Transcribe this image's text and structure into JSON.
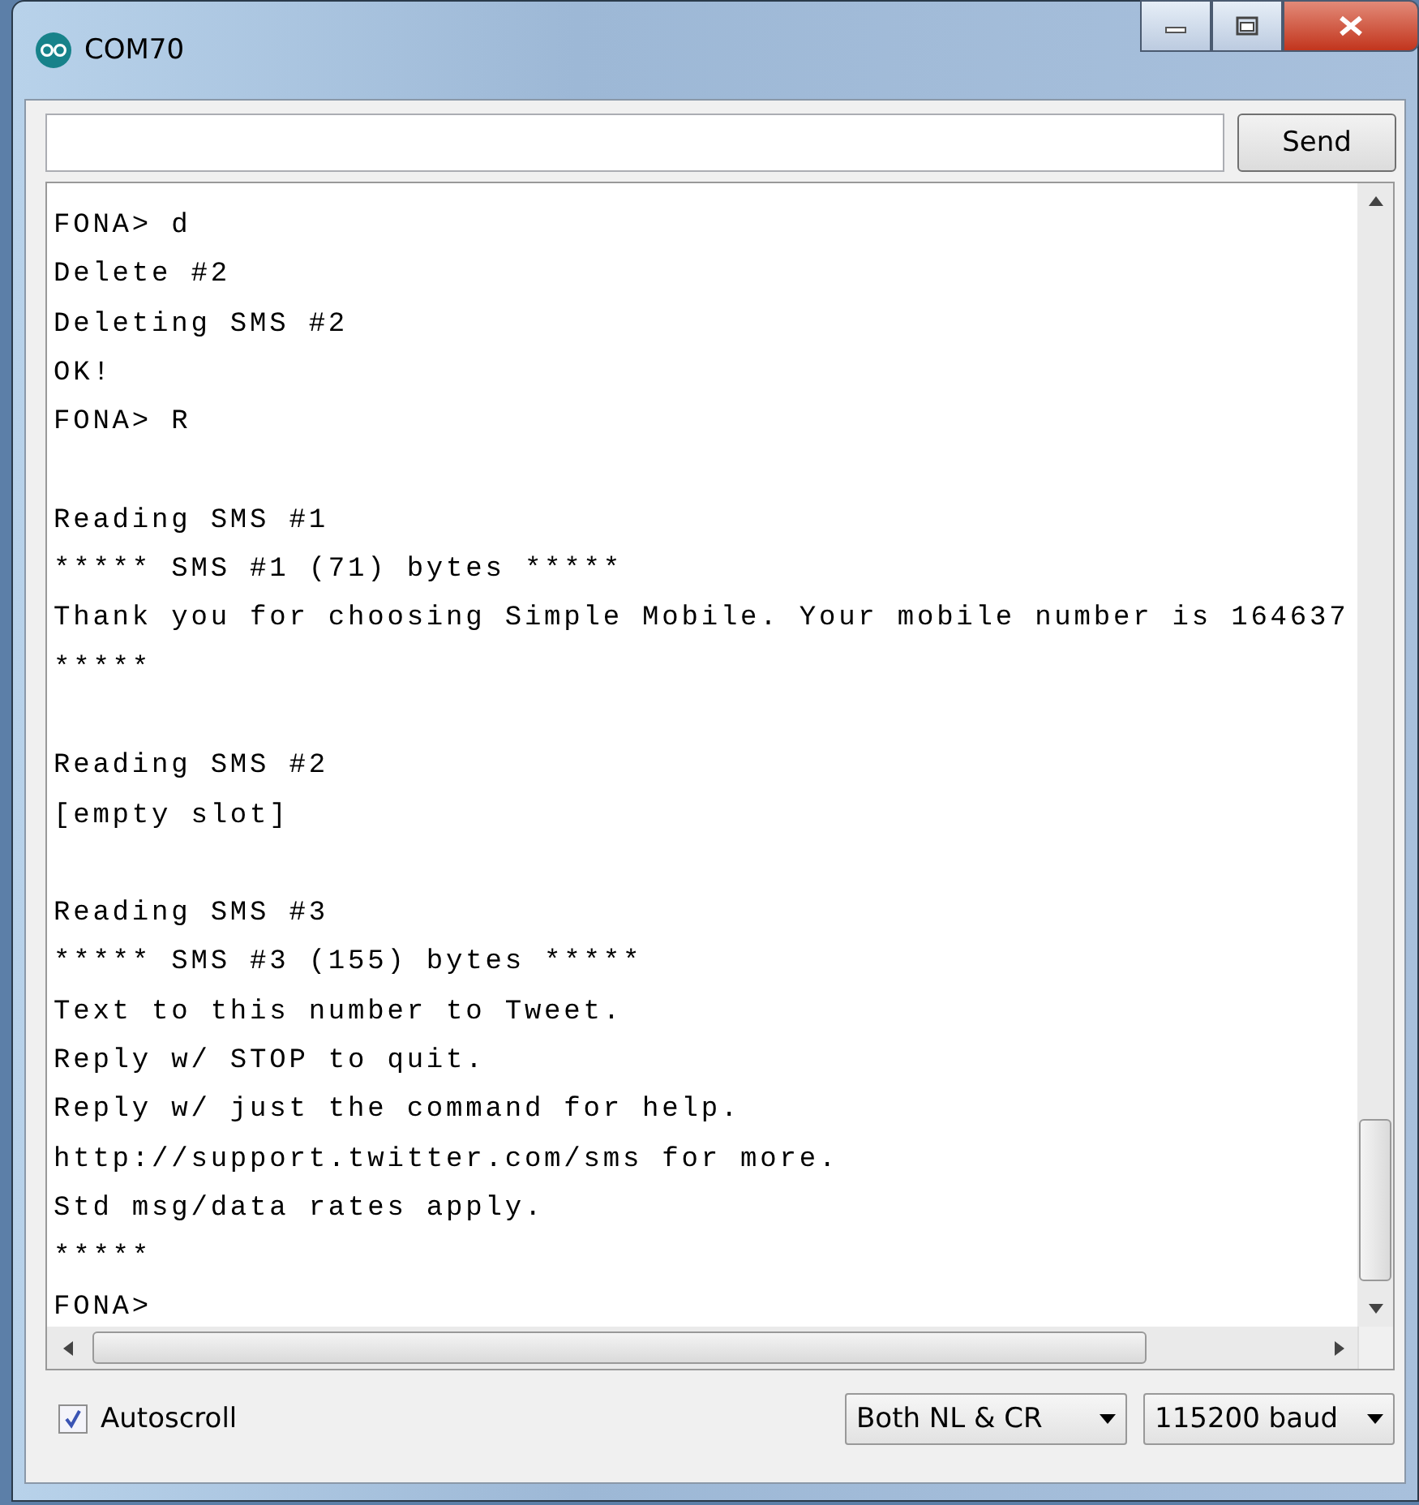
{
  "window": {
    "title": "COM70"
  },
  "input": {
    "button": "Send"
  },
  "output_lines": [
    {
      "text": "FONA> d",
      "blank_before": false
    },
    {
      "text": "Delete #2",
      "blank_before": false
    },
    {
      "text": "Deleting SMS #2",
      "blank_before": false
    },
    {
      "text": "OK!",
      "blank_before": false
    },
    {
      "text": "FONA> R",
      "blank_before": false
    },
    {
      "text": "Reading SMS #1",
      "blank_before": true
    },
    {
      "text": "***** SMS #1 (71) bytes *****",
      "blank_before": false
    },
    {
      "text": "Thank you for choosing Simple Mobile. Your mobile number is 164637",
      "blank_before": false
    },
    {
      "text": "*****",
      "blank_before": false
    },
    {
      "text": "Reading SMS #2",
      "blank_before": true
    },
    {
      "text": "[empty slot]",
      "blank_before": false
    },
    {
      "text": "Reading SMS #3",
      "blank_before": true
    },
    {
      "text": "***** SMS #3 (155) bytes *****",
      "blank_before": false
    },
    {
      "text": "Text to this number to Tweet.",
      "blank_before": false
    },
    {
      "text": "Reply w/ STOP to quit.",
      "blank_before": false
    },
    {
      "text": "Reply w/ just the command for help.",
      "blank_before": false
    },
    {
      "text": "http://support.twitter.com/sms for more.",
      "blank_before": false
    },
    {
      "text": "Std msg/data rates apply.",
      "blank_before": false
    },
    {
      "text": "*****",
      "blank_before": false
    },
    {
      "text": "FONA>",
      "blank_before": false
    }
  ],
  "footer": {
    "autoscroll": {
      "label": "Autoscroll",
      "checked": true
    },
    "line_ending": "Both NL & CR",
    "baud": "115200 baud"
  }
}
